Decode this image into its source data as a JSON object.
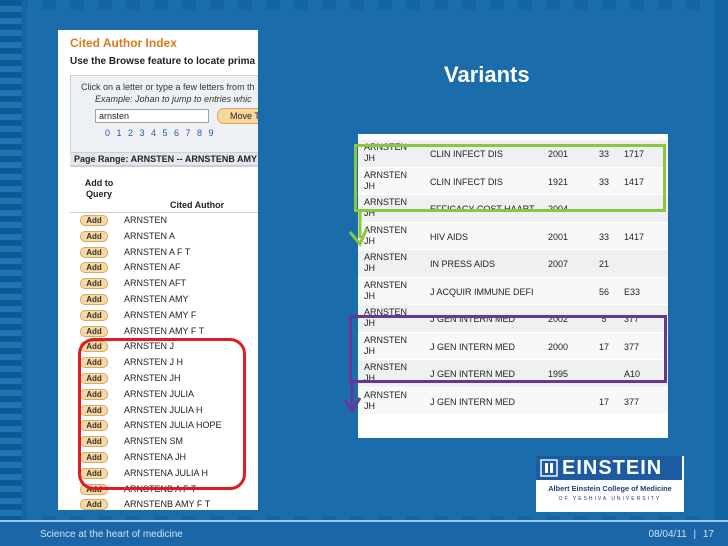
{
  "slide": {
    "title": "Variants"
  },
  "left_screenshot": {
    "title": "Cited Author Index",
    "subtitle": "Use the Browse feature to locate prima",
    "instruction": "Click on a letter or type a few letters from th",
    "example": "Example: Johan to jump to entries whic",
    "search_value": "arnsten",
    "move_button": "Move To",
    "digits": "0 1 2 3 4 5 6 7 8 9",
    "page_range": "Page Range: ARNSTEN -- ARNSTENB AMY F",
    "col_add_query": "Add to Query",
    "col_cited_author": "Cited Author",
    "add_label": "Add",
    "authors": [
      "ARNSTEN",
      "ARNSTEN A",
      "ARNSTEN A F T",
      "ARNSTEN AF",
      "ARNSTEN AFT",
      "ARNSTEN AMY",
      "ARNSTEN AMY F",
      "ARNSTEN AMY F T",
      "ARNSTEN J",
      "ARNSTEN J H",
      "ARNSTEN JH",
      "ARNSTEN JULIA",
      "ARNSTEN JULIA H",
      "ARNSTEN JULIA HOPE",
      "ARNSTEN SM",
      "ARNSTENA JH",
      "ARNSTENA JULIA H",
      "ARNSTENB A F T",
      "ARNSTENB AMY F T"
    ]
  },
  "variants": [
    {
      "author": "ARNSTEN JH",
      "journal": "CLIN INFECT DIS",
      "year": "2001",
      "vol": "33",
      "page": "1717"
    },
    {
      "author": "ARNSTEN JH",
      "journal": "CLIN INFECT DIS",
      "year": "1921",
      "vol": "33",
      "page": "1417"
    },
    {
      "author": "ARNSTEN JH",
      "journal": "EFFICACY COST HAART",
      "year": "2004",
      "vol": "",
      "page": ""
    },
    {
      "author": "ARNSTEN JH",
      "journal": "HIV AIDS",
      "year": "2001",
      "vol": "33",
      "page": "1417"
    },
    {
      "author": "ARNSTEN JH",
      "journal": "IN PRESS AIDS",
      "year": "2007",
      "vol": "21",
      "page": ""
    },
    {
      "author": "ARNSTEN JH",
      "journal": "J ACQUIR IMMUNE DEFI",
      "year": "",
      "vol": "56",
      "page": "E33"
    },
    {
      "author": "ARNSTEN JH",
      "journal": "J GEN INTERN MED",
      "year": "2002",
      "vol": "5",
      "page": "377"
    },
    {
      "author": "ARNSTEN JH",
      "journal": "J GEN INTERN MED",
      "year": "2000",
      "vol": "17",
      "page": "377"
    },
    {
      "author": "ARNSTEN JH",
      "journal": "J GEN INTERN MED",
      "year": "1995",
      "vol": "",
      "page": "A10"
    },
    {
      "author": "ARNSTEN JH",
      "journal": "J GEN INTERN MED",
      "year": "",
      "vol": "17",
      "page": "377"
    }
  ],
  "logo": {
    "name": "EINSTEIN",
    "college": "Albert Einstein College of Medicine",
    "university": "OF YESHIVA UNIVERSITY"
  },
  "footer": {
    "tagline": "Science at the heart of medicine",
    "date": "08/04/11",
    "separator": "|",
    "page": "17"
  },
  "colors": {
    "background": "#1a6cab",
    "green_highlight": "#8cc63e",
    "purple_highlight": "#6a3696",
    "red_highlight": "#e11b22"
  }
}
